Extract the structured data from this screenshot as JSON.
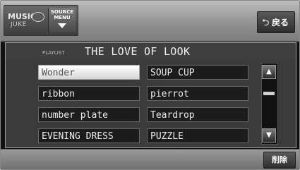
{
  "source": {
    "logo_music": "MUSIC",
    "logo_juke": "JUKE",
    "menu_label": "SOURCE\nMENU",
    "menu_icon": "chevron-down-icon"
  },
  "header": {
    "back_icon": "return-arrow-icon",
    "back_label": "戻る"
  },
  "playlist": {
    "tag": "PLAYLIST",
    "title": "THE LOVE OF LOOK",
    "tracks": [
      {
        "label": "Wonder",
        "selected": true
      },
      {
        "label": "SOUP CUP",
        "selected": false
      },
      {
        "label": "ribbon",
        "selected": false
      },
      {
        "label": "pierrot",
        "selected": false
      },
      {
        "label": "number plate",
        "selected": false
      },
      {
        "label": "Teardrop",
        "selected": false
      },
      {
        "label": "EVENING DRESS",
        "selected": false
      },
      {
        "label": "PUZZLE",
        "selected": false
      }
    ],
    "scroll_up_glyph": "▲",
    "scroll_down_glyph": "▼"
  },
  "footer": {
    "delete_label": "削除"
  },
  "colors": {
    "selected_bg": "#ffffff",
    "track_bg": "#1c1c1c",
    "panel_bg": "#3b3b3b"
  }
}
